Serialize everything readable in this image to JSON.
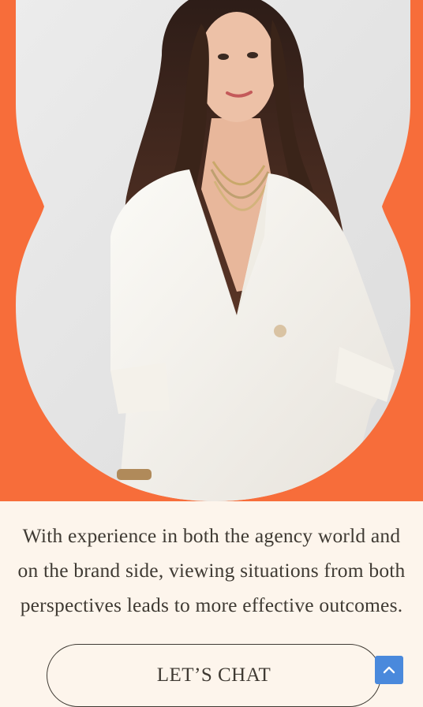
{
  "hero": {
    "image_alt": "Portrait of a woman in a white blazer",
    "accent_color": "#f76d3a"
  },
  "about": {
    "lines": [
      "With experience in both the agency world and",
      "on the brand side, viewing situations from both",
      "perspectives leads to more effective outcomes."
    ]
  },
  "cta": {
    "label": "LET’S CHAT"
  },
  "scroll_top": {
    "icon": "chevron-up-icon",
    "color": "#4a89dc"
  }
}
